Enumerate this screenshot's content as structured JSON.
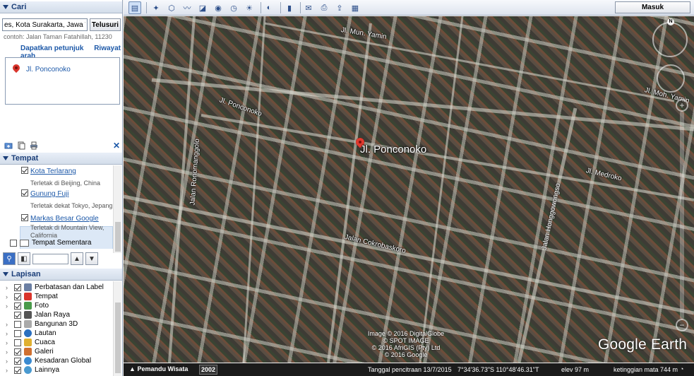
{
  "search": {
    "header": "Cari",
    "input_value": "es, Kota Surakarta, Jawa Tengah",
    "button": "Telusuri",
    "hint": "contoh: Jalan Taman Fatahillah, 11230",
    "directions_link": "Dapatkan petunjuk arah",
    "history_link": "Riwayat",
    "result": "Jl. Ponconoko"
  },
  "places": {
    "header": "Tempat",
    "items": [
      {
        "name": "Kota Terlarang",
        "desc": "Terletak di Beijing, China"
      },
      {
        "name": "Gunung Fuji",
        "desc": "Terletak dekat Tokyo, Jepang"
      },
      {
        "name": "Markas Besar Google",
        "desc": "Terletak di Mountain View, California"
      }
    ],
    "temp_folder": "Tempat Sementara"
  },
  "layers": {
    "header": "Lapisan",
    "items": [
      {
        "label": "Perbatasan dan Label",
        "icon": "borders-icon",
        "checked": true,
        "expandable": true
      },
      {
        "label": "Tempat",
        "icon": "places-icon",
        "checked": true,
        "expandable": true
      },
      {
        "label": "Foto",
        "icon": "photo-icon",
        "checked": true,
        "expandable": true
      },
      {
        "label": "Jalan Raya",
        "icon": "road-icon",
        "checked": true,
        "expandable": false
      },
      {
        "label": "Bangunan 3D",
        "icon": "building-icon",
        "checked": false,
        "expandable": true
      },
      {
        "label": "Lautan",
        "icon": "ocean-icon",
        "checked": false,
        "expandable": true
      },
      {
        "label": "Cuaca",
        "icon": "weather-icon",
        "checked": false,
        "expandable": true
      },
      {
        "label": "Galeri",
        "icon": "gallery-icon",
        "checked": true,
        "expandable": true
      },
      {
        "label": "Kesadaran Global",
        "icon": "globe-icon",
        "checked": true,
        "expandable": true
      },
      {
        "label": "Lainnya",
        "icon": "more-icon",
        "checked": true,
        "expandable": true
      }
    ]
  },
  "toolbar": {
    "signin": "Masuk"
  },
  "map": {
    "main_label": "Jl. Ponconoko",
    "roads": [
      {
        "text": "Jl. Mun. Yamin"
      },
      {
        "text": "Jl. Moh. Yamin"
      },
      {
        "text": "Jl. Ponconoko"
      },
      {
        "text": "Jalan Ronomanggolo"
      },
      {
        "text": "Jl. Medroko"
      },
      {
        "text": "Jalan Honggowongso"
      },
      {
        "text": "Jalan Cokrobaskoro"
      }
    ],
    "copyright": [
      "Image © 2016 DigitalGlobe",
      "© SPOT IMAGE",
      "© 2016 AfriGIS (Pty) Ltd",
      "© 2016 Google"
    ],
    "logo": "Google Earth",
    "compass_north": "N"
  },
  "status": {
    "tour": "Pemandu Wisata",
    "year": "2002",
    "imagery_date": "Tanggal pencitraan 13/7/2015",
    "coords": "7°34'36.73\"S  110°48'46.31\"T",
    "elev": "elev   97 m",
    "eye_alt": "ketinggian mata   744 m"
  },
  "colors": {
    "panel_header": "#1c3f79",
    "link": "#1c58a8",
    "pin": "#e03a2f"
  }
}
